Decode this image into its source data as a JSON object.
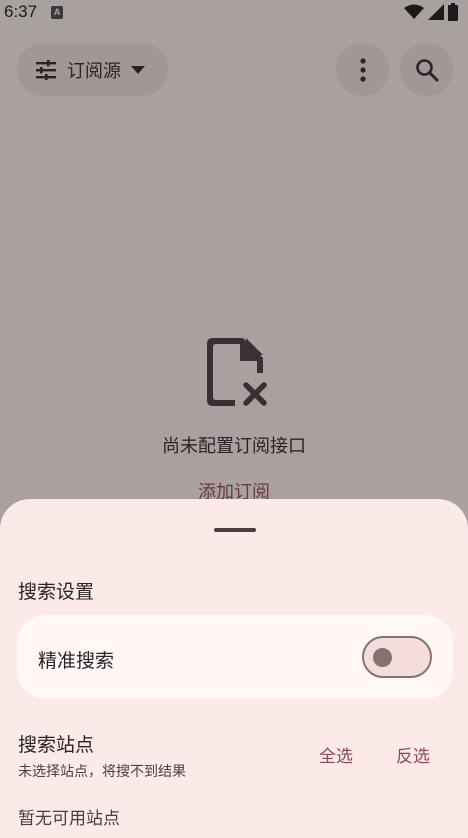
{
  "status": {
    "time": "6:37",
    "notif": "A"
  },
  "toolbar": {
    "source_label": "订阅源",
    "more_icon": "more-vert-icon",
    "search_icon": "search-icon",
    "filter_icon": "tune-icon"
  },
  "empty": {
    "icon": "file-error-icon",
    "message": "尚未配置订阅接口",
    "add_link": "添加订阅"
  },
  "sheet": {
    "title": "搜索设置",
    "precise_label": "精准搜索",
    "precise_on": false,
    "sites_title": "搜索站点",
    "sites_subtitle": "未选择站点，将搜不到结果",
    "select_all": "全选",
    "invert": "反选",
    "no_sites": "暂无可用站点"
  }
}
